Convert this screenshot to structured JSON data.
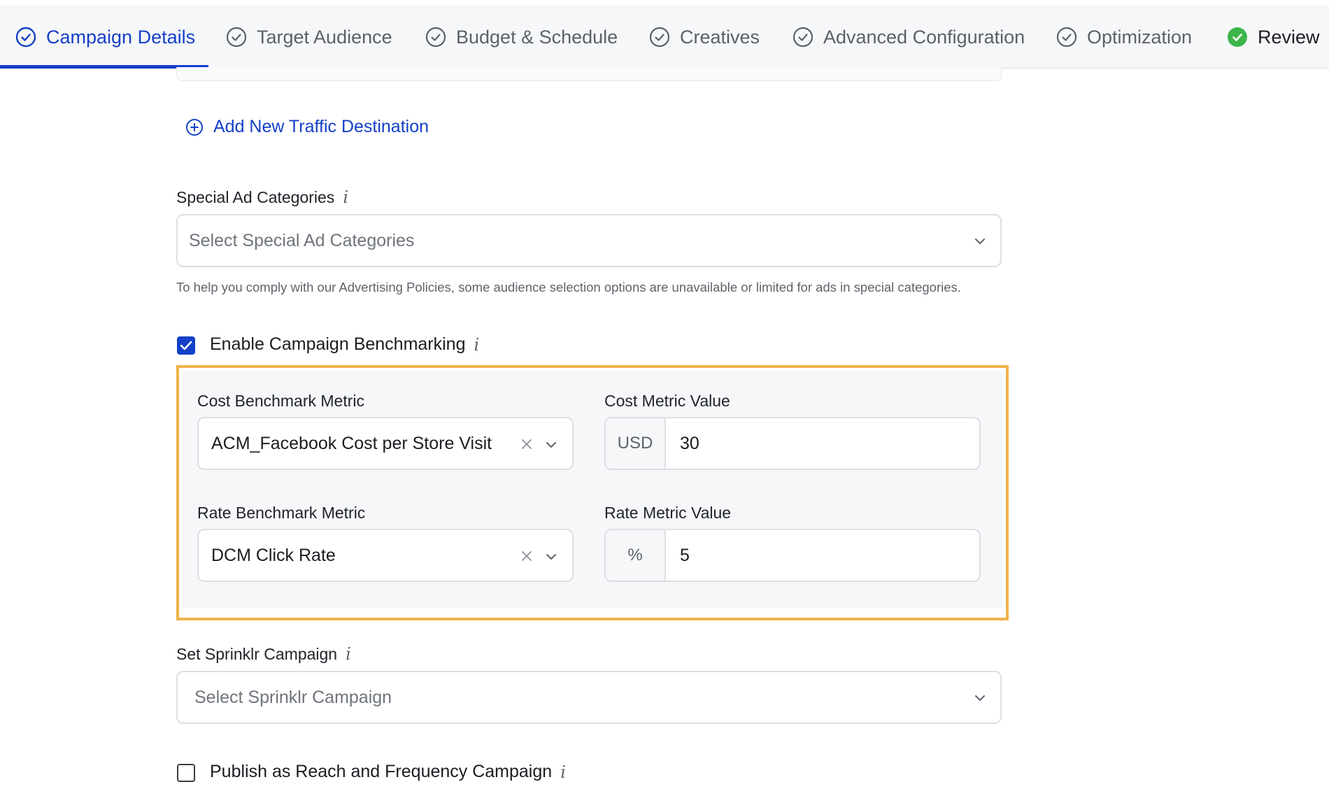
{
  "stepper": {
    "steps": [
      {
        "label": "Campaign Details",
        "state": "active"
      },
      {
        "label": "Target Audience",
        "state": "pending"
      },
      {
        "label": "Budget & Schedule",
        "state": "pending"
      },
      {
        "label": "Creatives",
        "state": "pending"
      },
      {
        "label": "Advanced Configuration",
        "state": "pending"
      },
      {
        "label": "Optimization",
        "state": "pending"
      },
      {
        "label": "Review",
        "state": "complete"
      }
    ]
  },
  "traffic": {
    "add_label": "Add New Traffic Destination"
  },
  "special_ad": {
    "label": "Special Ad Categories",
    "placeholder": "Select Special Ad Categories",
    "helper": "To help you comply with our Advertising Policies, some audience selection options are unavailable or limited for ads in special categories."
  },
  "benchmarking": {
    "label": "Enable Campaign Benchmarking",
    "checked": true,
    "cost_metric_label": "Cost Benchmark Metric",
    "cost_metric_value": "ACM_Facebook Cost per Store Visit",
    "cost_value_label": "Cost Metric Value",
    "cost_prefix": "USD",
    "cost_value": "30",
    "rate_metric_label": "Rate Benchmark Metric",
    "rate_metric_value": "DCM Click Rate",
    "rate_value_label": "Rate Metric Value",
    "rate_prefix": "%",
    "rate_value": "5"
  },
  "sprinklr": {
    "label": "Set Sprinklr Campaign",
    "placeholder": "Select Sprinklr Campaign"
  },
  "reach_frequency": {
    "label": "Publish as Reach and Frequency Campaign",
    "checked": false
  },
  "info_glyph": "i",
  "colors": {
    "accent": "#1440c8",
    "success": "#3cb54a",
    "highlight": "#f0b44a"
  }
}
